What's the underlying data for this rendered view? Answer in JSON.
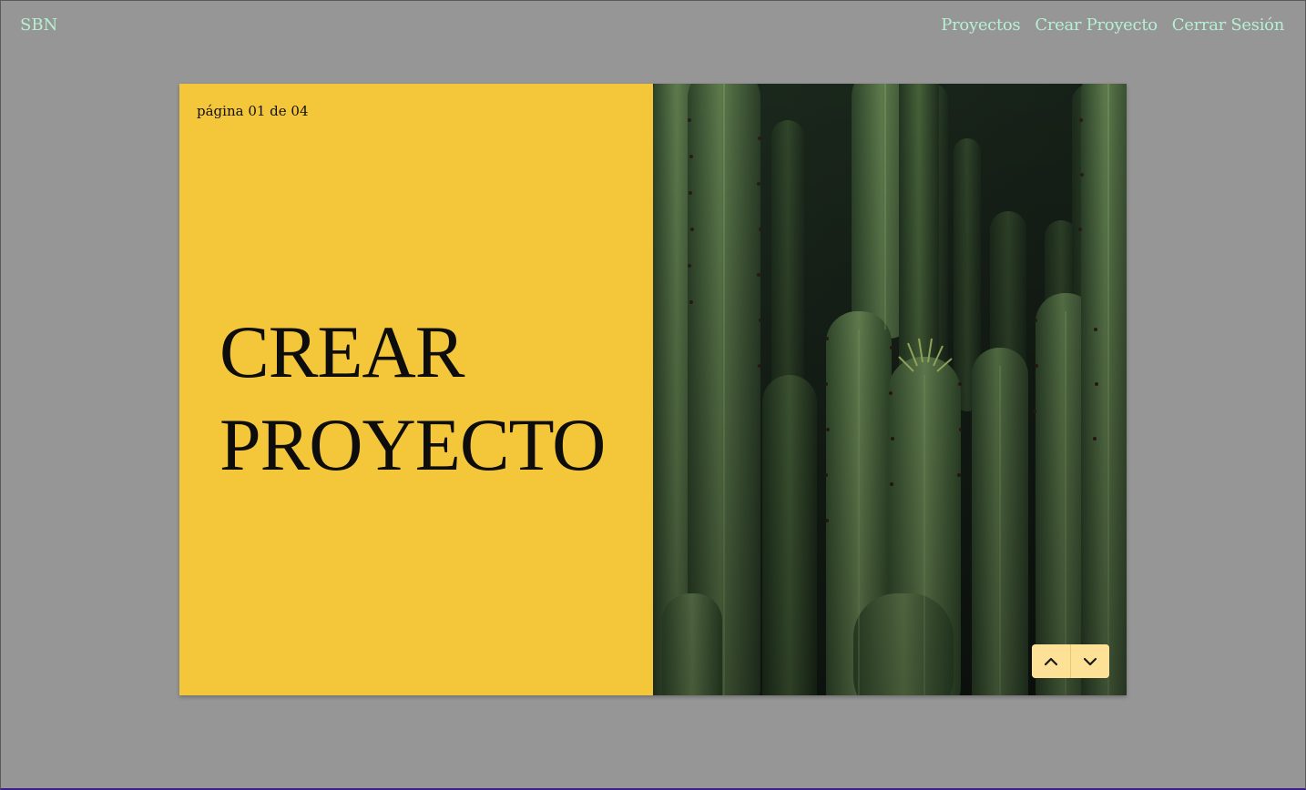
{
  "navbar": {
    "brand": "SBN",
    "links": [
      {
        "label": "Proyectos"
      },
      {
        "label": "Crear Proyecto"
      },
      {
        "label": "Cerrar Sesión"
      }
    ]
  },
  "slide": {
    "page_indicator": "página 01 de 04",
    "title_line1": "CREAR",
    "title_line2": "PROYECTO",
    "panel_color": "#f4c63a",
    "image_subject": "cactus photo"
  },
  "pager": {
    "prev_icon": "chevron-up-icon",
    "next_icon": "chevron-down-icon",
    "button_color": "#fde196"
  },
  "colors": {
    "page_background": "#969696",
    "nav_link": "#b6f0d2"
  }
}
